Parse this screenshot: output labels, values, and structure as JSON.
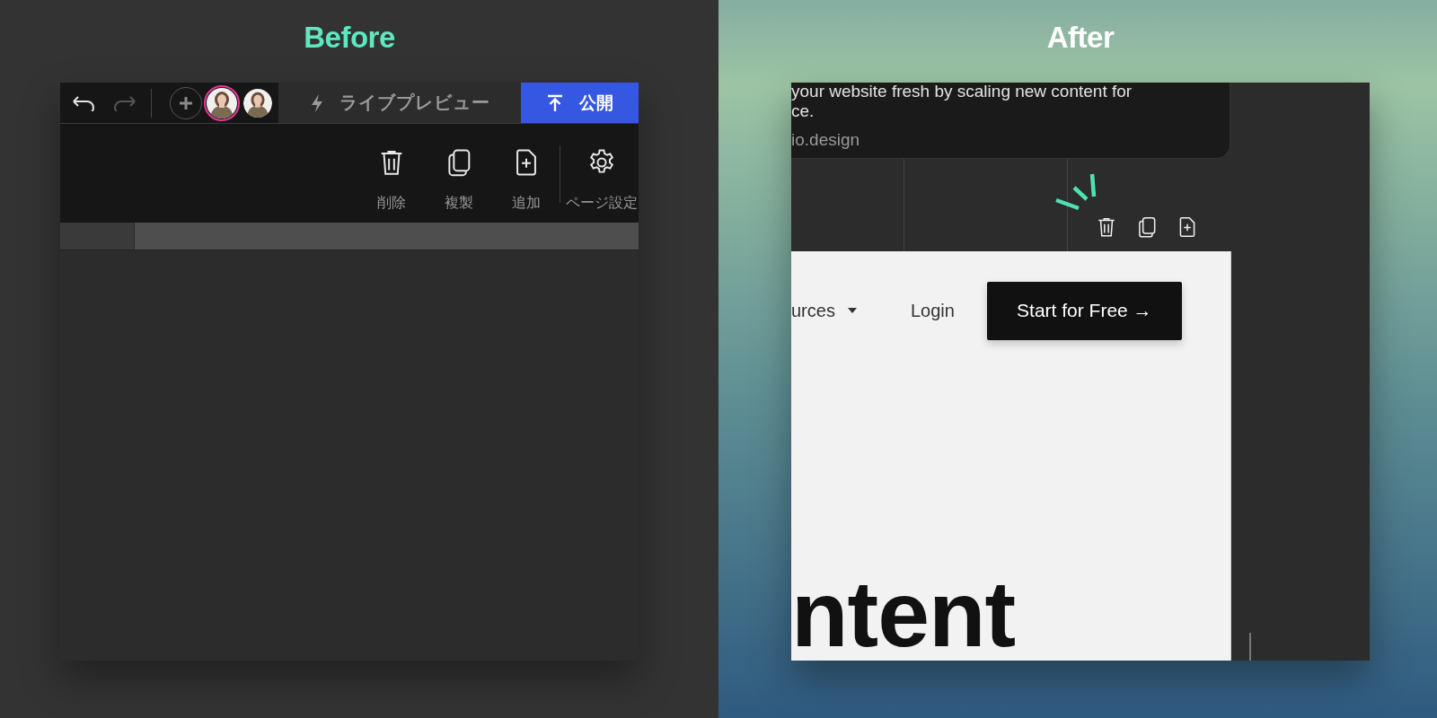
{
  "before": {
    "label": "Before",
    "history": [
      {
        "kind": "undo",
        "disabled": false
      },
      {
        "kind": "redo",
        "disabled": true
      }
    ],
    "avatars": [
      {
        "selected": true
      },
      {
        "selected": false
      }
    ],
    "live_preview": "ライブプレビュー",
    "publish": "公開",
    "actions": [
      {
        "kind": "delete",
        "label": "削除"
      },
      {
        "kind": "duplicate",
        "label": "複製"
      },
      {
        "kind": "add",
        "label": "追加"
      },
      {
        "kind": "settings",
        "label": "ページ設定"
      }
    ]
  },
  "after": {
    "label": "After",
    "card_lines": [
      "your website fresh by scaling new content for",
      "ce."
    ],
    "card_link": "io.design",
    "actions": [
      {
        "kind": "delete"
      },
      {
        "kind": "duplicate"
      },
      {
        "kind": "add"
      }
    ],
    "nav": [
      {
        "label": "urces",
        "dropdown": true
      },
      {
        "label": "Login",
        "dropdown": false
      }
    ],
    "cta": "Start for Free →",
    "headline": "ntent"
  }
}
